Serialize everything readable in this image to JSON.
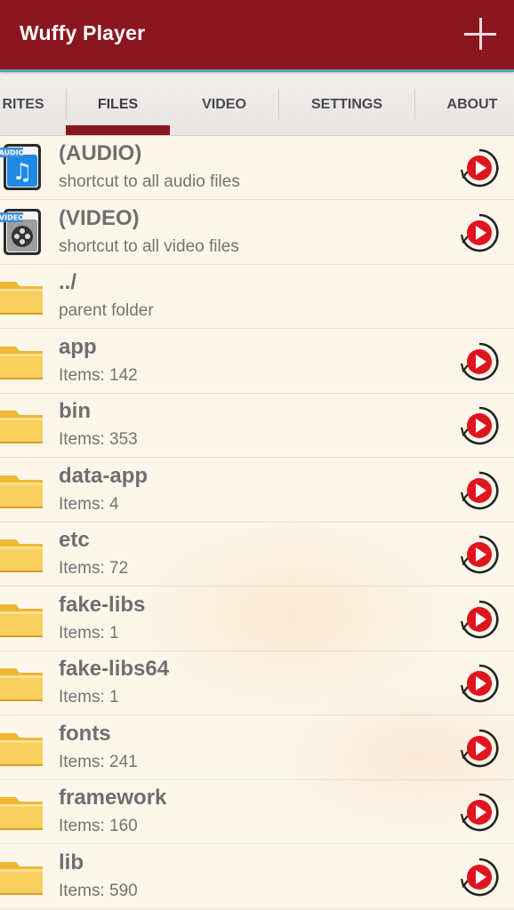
{
  "app": {
    "title": "Wuffy Player",
    "accent_color": "#8a1620",
    "add_icon": "plus-icon"
  },
  "tabs": [
    {
      "label": "RITES",
      "selected": false
    },
    {
      "label": "FILES",
      "selected": true
    },
    {
      "label": "VIDEO",
      "selected": false
    },
    {
      "label": "SETTINGS",
      "selected": false
    },
    {
      "label": "ABOUT",
      "selected": false
    }
  ],
  "files": {
    "items": [
      {
        "title": "(AUDIO)",
        "subtitle": "shortcut to all audio files",
        "icon": "audio-file-icon",
        "play": true
      },
      {
        "title": "(VIDEO)",
        "subtitle": "shortcut to all video files",
        "icon": "video-file-icon",
        "play": true
      },
      {
        "title": "../",
        "subtitle": "parent folder",
        "icon": "folder-icon",
        "play": false
      },
      {
        "title": "app",
        "subtitle": "Items: 142",
        "icon": "folder-icon",
        "play": true
      },
      {
        "title": "bin",
        "subtitle": "Items: 353",
        "icon": "folder-icon",
        "play": true
      },
      {
        "title": "data-app",
        "subtitle": "Items: 4",
        "icon": "folder-icon",
        "play": true
      },
      {
        "title": "etc",
        "subtitle": "Items: 72",
        "icon": "folder-icon",
        "play": true
      },
      {
        "title": "fake-libs",
        "subtitle": "Items: 1",
        "icon": "folder-icon",
        "play": true
      },
      {
        "title": "fake-libs64",
        "subtitle": "Items: 1",
        "icon": "folder-icon",
        "play": true
      },
      {
        "title": "fonts",
        "subtitle": "Items: 241",
        "icon": "folder-icon",
        "play": true
      },
      {
        "title": "framework",
        "subtitle": "Items: 160",
        "icon": "folder-icon",
        "play": true
      },
      {
        "title": "lib",
        "subtitle": "Items: 590",
        "icon": "folder-icon",
        "play": true
      }
    ],
    "audio_badge": "AUDIO",
    "video_badge": "VIDEO",
    "play_icon": "play-circle-icon",
    "play_color": "#e0141e"
  }
}
